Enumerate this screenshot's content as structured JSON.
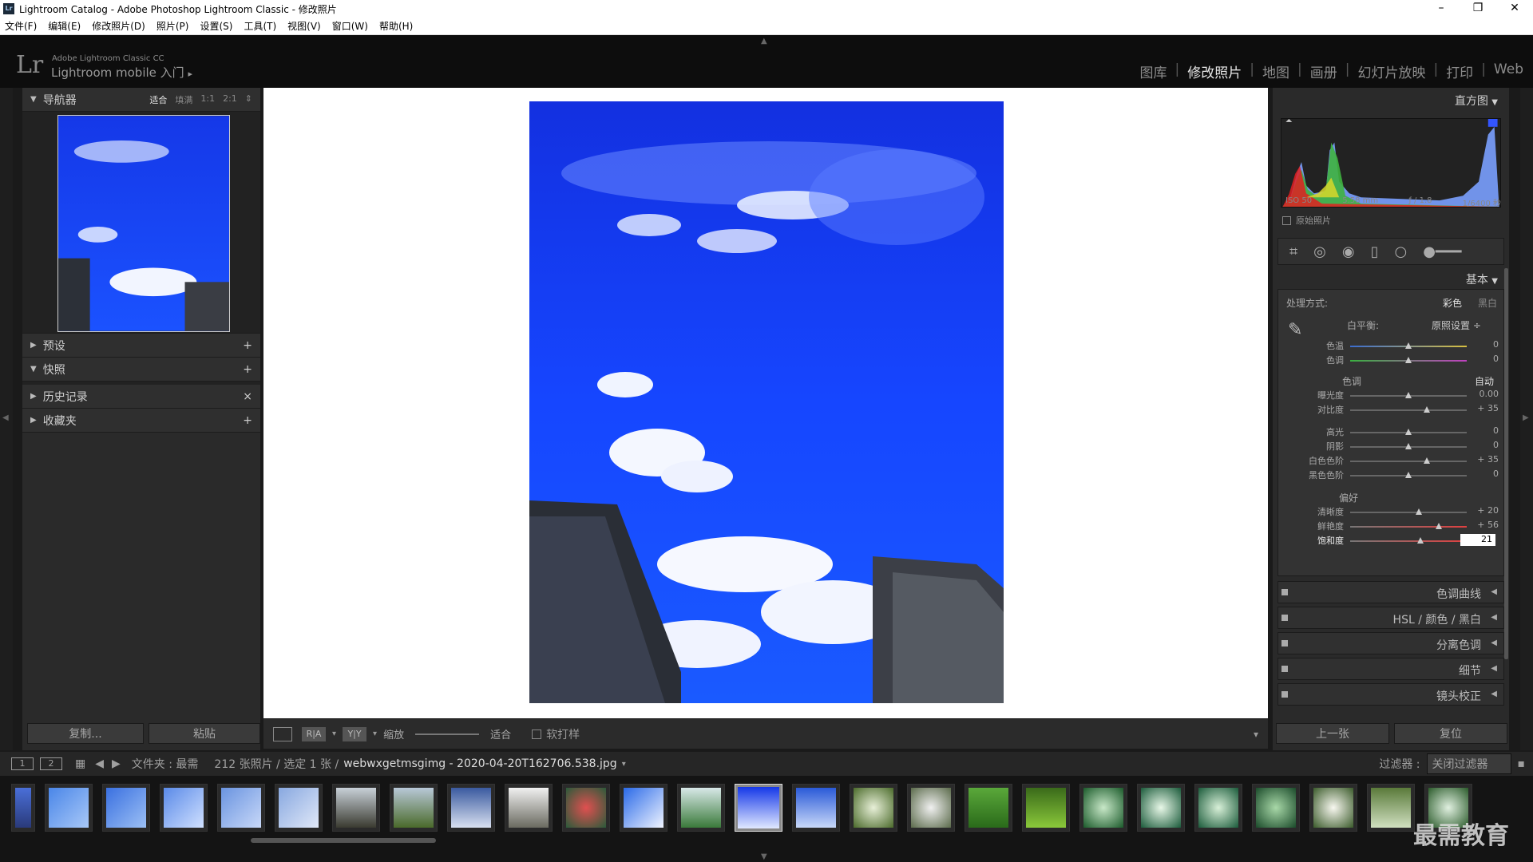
{
  "window": {
    "title": "Lightroom Catalog - Adobe Photoshop Lightroom Classic - 修改照片",
    "app_icon": "Lr",
    "minimize": "–",
    "maximize": "❐",
    "close": "✕"
  },
  "menu": [
    "文件(F)",
    "编辑(E)",
    "修改照片(D)",
    "照片(P)",
    "设置(S)",
    "工具(T)",
    "视图(V)",
    "窗口(W)",
    "帮助(H)"
  ],
  "identity": {
    "logo": "Lr",
    "small": "Adobe Lightroom Classic CC",
    "big": "Lightroom mobile 入门",
    "arrow": "▸"
  },
  "modules": [
    "图库",
    "修改照片",
    "地图",
    "画册",
    "幻灯片放映",
    "打印",
    "Web"
  ],
  "module_separator": "|",
  "navigator": {
    "title": "导航器",
    "opts": [
      "适合",
      "填满",
      "1:1",
      "2:1"
    ],
    "opts_arrow": "⇕"
  },
  "left_panels": [
    {
      "title": "预设",
      "action": "+"
    },
    {
      "title": "快照",
      "action": "+"
    },
    {
      "title": "历史记录",
      "action": "×"
    },
    {
      "title": "收藏夹",
      "action": "+"
    }
  ],
  "left_buttons": {
    "copy": "复制...",
    "paste": "粘贴"
  },
  "toolbar": {
    "zoom_label": "缩放",
    "zoom_value": "适合",
    "soft_proof": "软打样",
    "ra": "R|A",
    "yy": "Y|Y",
    "chevron": "▾"
  },
  "histogram": {
    "title": "直方图",
    "iso": "ISO 50",
    "focal": "5.58 mm",
    "aperture": "ƒ / 1.8",
    "shutter": "1/6400 秒",
    "original": "原始照片"
  },
  "basic": {
    "title": "基本",
    "treatment_label": "处理方式:",
    "color": "彩色",
    "bw": "黑白",
    "wb_label": "白平衡:",
    "wb_value": "原照设置 ÷",
    "tone_label": "色调",
    "auto": "自动",
    "presence_label": "偏好",
    "sliders": [
      {
        "label": "色温",
        "value": "0",
        "pos": 0.5
      },
      {
        "label": "色调",
        "value": "0",
        "pos": 0.5
      },
      {
        "label": "曝光度",
        "value": "0.00",
        "pos": 0.5
      },
      {
        "label": "对比度",
        "value": "+ 35",
        "pos": 0.66
      },
      {
        "label": "高光",
        "value": "0",
        "pos": 0.5
      },
      {
        "label": "阴影",
        "value": "0",
        "pos": 0.5
      },
      {
        "label": "白色色阶",
        "value": "+ 35",
        "pos": 0.66
      },
      {
        "label": "黑色色阶",
        "value": "0",
        "pos": 0.5
      },
      {
        "label": "清晰度",
        "value": "+ 20",
        "pos": 0.59
      },
      {
        "label": "鲜艳度",
        "value": "+ 56",
        "pos": 0.76
      },
      {
        "label": "饱和度",
        "value": "21",
        "pos": 0.6
      }
    ]
  },
  "right_sections": [
    "色调曲线",
    "HSL / 颜色 / 黑白",
    "分离色调",
    "细节",
    "镜头校正"
  ],
  "right_buttons": {
    "prev": "上一张",
    "reset": "复位"
  },
  "filmbar": {
    "page1": "1",
    "page2": "2",
    "source": "文件夹 : 最需",
    "count": "212 张照片 / 选定 1 张 /",
    "filename": "webwxgetmsgimg - 2020-04-20T162706.538.jpg",
    "filter_label": "过滤器 :",
    "filter_value": "关闭过滤器",
    "filename_arrow": "▾"
  },
  "watermark": "最需教育",
  "colors": {
    "accent": "#e6e6e6",
    "sky": "#1a3cff"
  }
}
